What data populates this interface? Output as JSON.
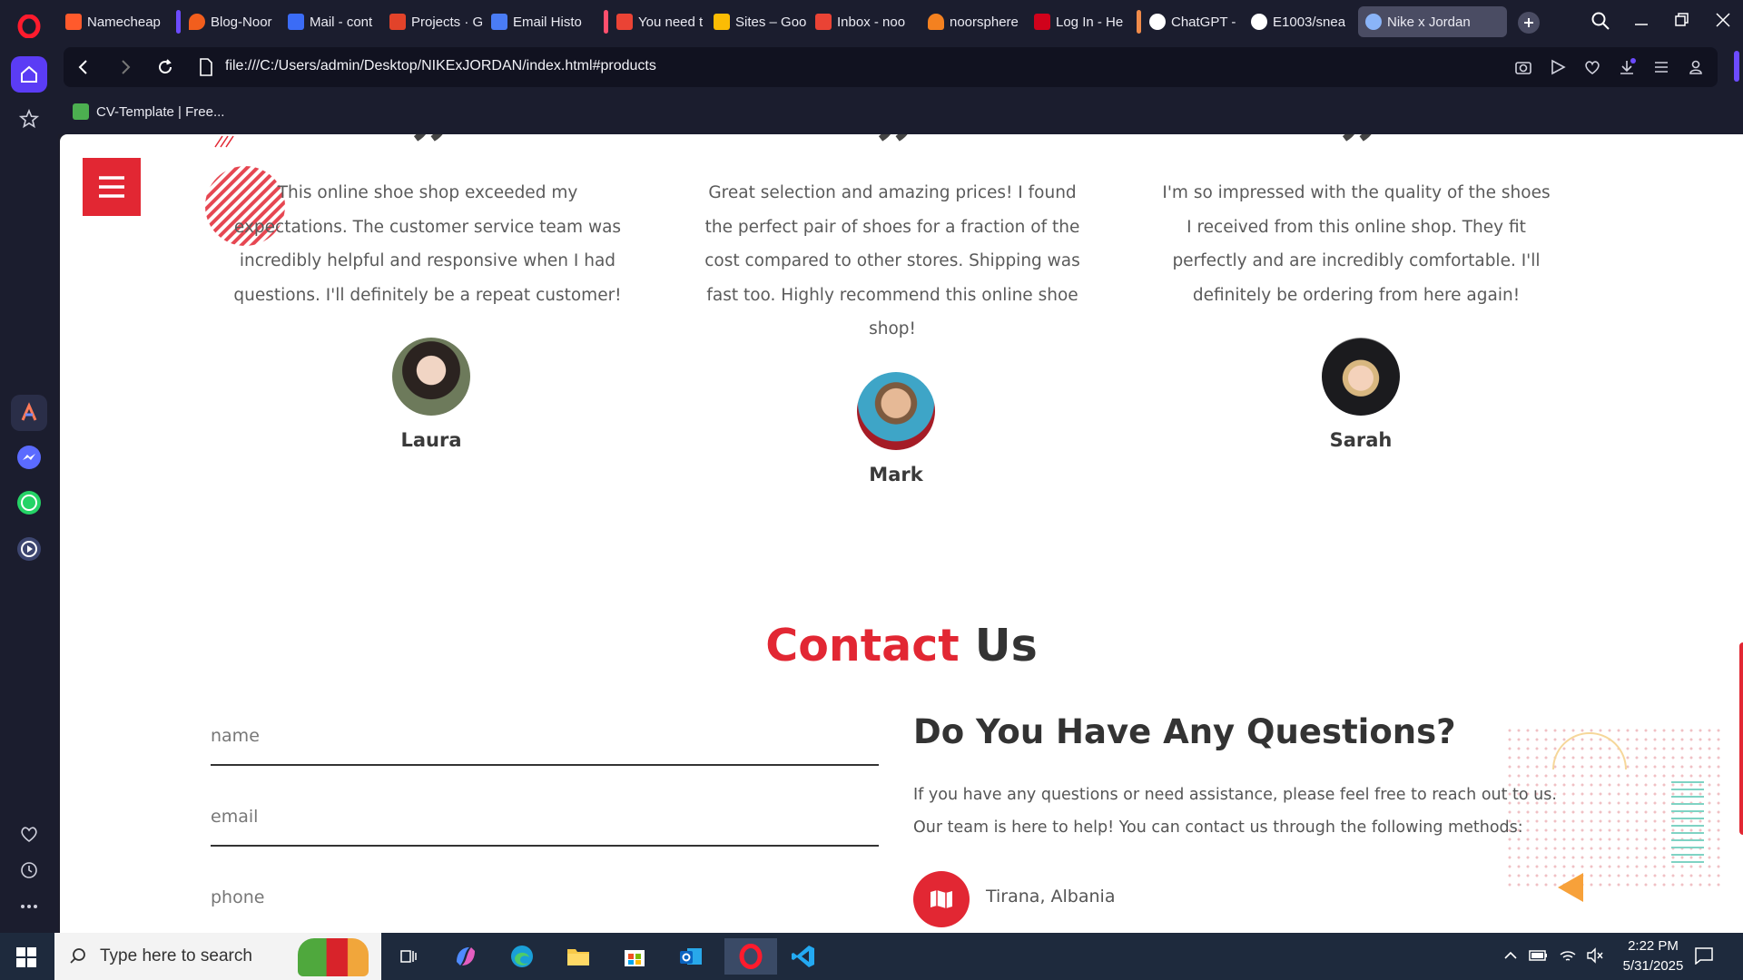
{
  "browser": {
    "tabs": [
      {
        "label": "Namecheap",
        "color": "#ff5a2c"
      },
      {
        "label": "Blog-Noor",
        "color": "#f25e1d"
      },
      {
        "label": "Mail - cont",
        "color": "#3b6cf6"
      },
      {
        "label": "Projects · G",
        "color": "#e2432a"
      },
      {
        "label": "Email Histo",
        "color": "#4a7cf5"
      },
      {
        "label": "You need t",
        "color": "#ea4335"
      },
      {
        "label": "Sites – Goo",
        "color": "#fbbc04"
      },
      {
        "label": "Inbox - noo",
        "color": "#ea4335"
      },
      {
        "label": "noorsphere",
        "color": "#f48120"
      },
      {
        "label": "Log In - He",
        "color": "#d0021b"
      },
      {
        "label": "ChatGPT - ",
        "color": "#ffffff"
      },
      {
        "label": "E1003/snea",
        "color": "#ffffff"
      },
      {
        "label": "Nike x Jordan",
        "color": "#8ab4f8"
      }
    ],
    "url": "file:///C:/Users/admin/Desktop/NIKExJORDAN/index.html#products",
    "bookmark": "CV-Template | Free..."
  },
  "testimonials": [
    {
      "text": "This online shoe shop exceeded my expectations. The customer service team was incredibly helpful and responsive when I had questions. I'll definitely be a repeat customer!",
      "name": "Laura"
    },
    {
      "text": "Great selection and amazing prices! I found the perfect pair of shoes for a fraction of the cost compared to other stores. Shipping was fast too. Highly recommend this online shoe shop!",
      "name": "Mark"
    },
    {
      "text": "I'm so impressed with the quality of the shoes I received from this online shop. They fit perfectly and are incredibly comfortable. I'll definitely be ordering from here again!",
      "name": "Sarah"
    }
  ],
  "contact": {
    "title_accent": "Contact",
    "title_rest": " Us",
    "name_placeholder": "name",
    "email_placeholder": "email",
    "phone_placeholder": "phone",
    "question_title": "Do You Have Any Questions?",
    "question_text": "If you have any questions or need assistance, please feel free to reach out to us. Our team is here to help! You can contact us through the following methods:",
    "location": "Tirana, Albania"
  },
  "taskbar": {
    "search_placeholder": "Type here to search",
    "time": "2:22 PM",
    "date": "5/31/2025"
  },
  "colors": {
    "accent": "#e22733",
    "opera": "#5b3cf5"
  }
}
